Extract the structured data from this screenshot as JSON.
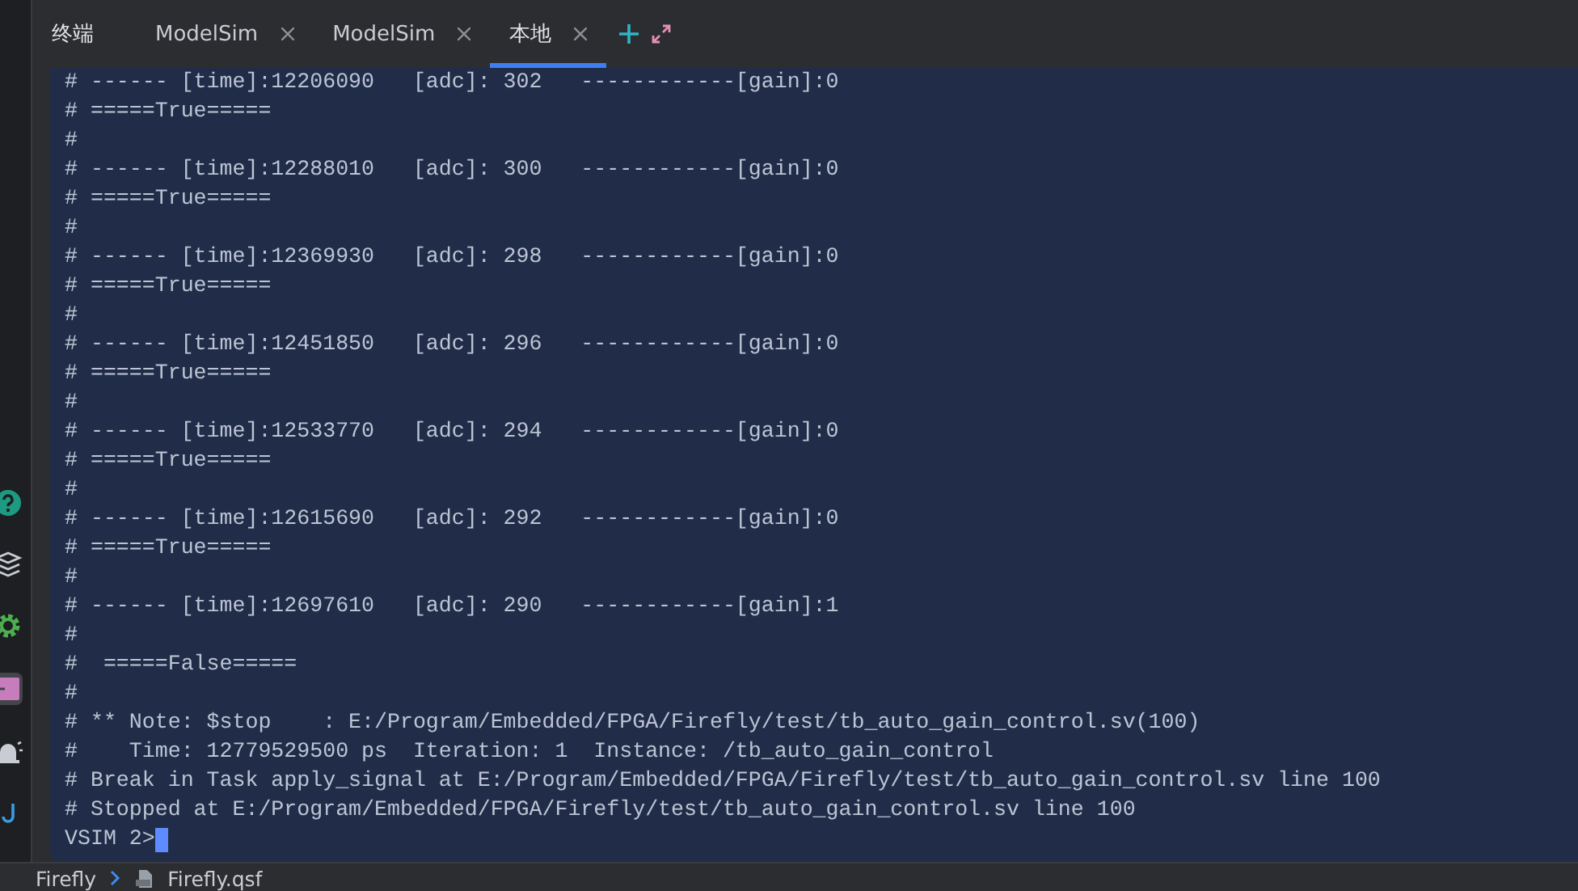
{
  "panel_title": "终端",
  "tabs": [
    {
      "label": "ModelSim",
      "selected": false
    },
    {
      "label": "ModelSim",
      "selected": false
    },
    {
      "label": "本地",
      "selected": true
    }
  ],
  "lines": [
    "# ------ [time]:12206090   [adc]: 302   ------------[gain]:0",
    "# =====True=====",
    "#",
    "# ------ [time]:12288010   [adc]: 300   ------------[gain]:0",
    "# =====True=====",
    "#",
    "# ------ [time]:12369930   [adc]: 298   ------------[gain]:0",
    "# =====True=====",
    "#",
    "# ------ [time]:12451850   [adc]: 296   ------------[gain]:0",
    "# =====True=====",
    "#",
    "# ------ [time]:12533770   [adc]: 294   ------------[gain]:0",
    "# =====True=====",
    "#",
    "# ------ [time]:12615690   [adc]: 292   ------------[gain]:0",
    "# =====True=====",
    "#",
    "# ------ [time]:12697610   [adc]: 290   ------------[gain]:1",
    "#",
    "#  =====False=====",
    "#",
    "# ** Note: $stop    : E:/Program/Embedded/FPGA/Firefly/test/tb_auto_gain_control.sv(100)",
    "#    Time: 12779529500 ps  Iteration: 1  Instance: /tb_auto_gain_control",
    "# Break in Task apply_signal at E:/Program/Embedded/FPGA/Firefly/test/tb_auto_gain_control.sv line 100",
    "# Stopped at E:/Program/Embedded/FPGA/Firefly/test/tb_auto_gain_control.sv line 100"
  ],
  "prompt": "VSIM 2>",
  "breadcrumb": [
    "Firefly",
    "Firefly.qsf"
  ]
}
